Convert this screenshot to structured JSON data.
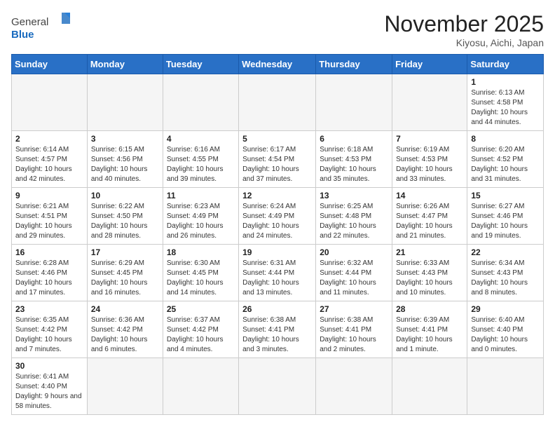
{
  "header": {
    "logo_general": "General",
    "logo_blue": "Blue",
    "month_title": "November 2025",
    "subtitle": "Kiyosu, Aichi, Japan"
  },
  "days_of_week": [
    "Sunday",
    "Monday",
    "Tuesday",
    "Wednesday",
    "Thursday",
    "Friday",
    "Saturday"
  ],
  "weeks": [
    [
      {
        "day": "",
        "info": ""
      },
      {
        "day": "",
        "info": ""
      },
      {
        "day": "",
        "info": ""
      },
      {
        "day": "",
        "info": ""
      },
      {
        "day": "",
        "info": ""
      },
      {
        "day": "",
        "info": ""
      },
      {
        "day": "1",
        "info": "Sunrise: 6:13 AM\nSunset: 4:58 PM\nDaylight: 10 hours and 44 minutes."
      }
    ],
    [
      {
        "day": "2",
        "info": "Sunrise: 6:14 AM\nSunset: 4:57 PM\nDaylight: 10 hours and 42 minutes."
      },
      {
        "day": "3",
        "info": "Sunrise: 6:15 AM\nSunset: 4:56 PM\nDaylight: 10 hours and 40 minutes."
      },
      {
        "day": "4",
        "info": "Sunrise: 6:16 AM\nSunset: 4:55 PM\nDaylight: 10 hours and 39 minutes."
      },
      {
        "day": "5",
        "info": "Sunrise: 6:17 AM\nSunset: 4:54 PM\nDaylight: 10 hours and 37 minutes."
      },
      {
        "day": "6",
        "info": "Sunrise: 6:18 AM\nSunset: 4:53 PM\nDaylight: 10 hours and 35 minutes."
      },
      {
        "day": "7",
        "info": "Sunrise: 6:19 AM\nSunset: 4:53 PM\nDaylight: 10 hours and 33 minutes."
      },
      {
        "day": "8",
        "info": "Sunrise: 6:20 AM\nSunset: 4:52 PM\nDaylight: 10 hours and 31 minutes."
      }
    ],
    [
      {
        "day": "9",
        "info": "Sunrise: 6:21 AM\nSunset: 4:51 PM\nDaylight: 10 hours and 29 minutes."
      },
      {
        "day": "10",
        "info": "Sunrise: 6:22 AM\nSunset: 4:50 PM\nDaylight: 10 hours and 28 minutes."
      },
      {
        "day": "11",
        "info": "Sunrise: 6:23 AM\nSunset: 4:49 PM\nDaylight: 10 hours and 26 minutes."
      },
      {
        "day": "12",
        "info": "Sunrise: 6:24 AM\nSunset: 4:49 PM\nDaylight: 10 hours and 24 minutes."
      },
      {
        "day": "13",
        "info": "Sunrise: 6:25 AM\nSunset: 4:48 PM\nDaylight: 10 hours and 22 minutes."
      },
      {
        "day": "14",
        "info": "Sunrise: 6:26 AM\nSunset: 4:47 PM\nDaylight: 10 hours and 21 minutes."
      },
      {
        "day": "15",
        "info": "Sunrise: 6:27 AM\nSunset: 4:46 PM\nDaylight: 10 hours and 19 minutes."
      }
    ],
    [
      {
        "day": "16",
        "info": "Sunrise: 6:28 AM\nSunset: 4:46 PM\nDaylight: 10 hours and 17 minutes."
      },
      {
        "day": "17",
        "info": "Sunrise: 6:29 AM\nSunset: 4:45 PM\nDaylight: 10 hours and 16 minutes."
      },
      {
        "day": "18",
        "info": "Sunrise: 6:30 AM\nSunset: 4:45 PM\nDaylight: 10 hours and 14 minutes."
      },
      {
        "day": "19",
        "info": "Sunrise: 6:31 AM\nSunset: 4:44 PM\nDaylight: 10 hours and 13 minutes."
      },
      {
        "day": "20",
        "info": "Sunrise: 6:32 AM\nSunset: 4:44 PM\nDaylight: 10 hours and 11 minutes."
      },
      {
        "day": "21",
        "info": "Sunrise: 6:33 AM\nSunset: 4:43 PM\nDaylight: 10 hours and 10 minutes."
      },
      {
        "day": "22",
        "info": "Sunrise: 6:34 AM\nSunset: 4:43 PM\nDaylight: 10 hours and 8 minutes."
      }
    ],
    [
      {
        "day": "23",
        "info": "Sunrise: 6:35 AM\nSunset: 4:42 PM\nDaylight: 10 hours and 7 minutes."
      },
      {
        "day": "24",
        "info": "Sunrise: 6:36 AM\nSunset: 4:42 PM\nDaylight: 10 hours and 6 minutes."
      },
      {
        "day": "25",
        "info": "Sunrise: 6:37 AM\nSunset: 4:42 PM\nDaylight: 10 hours and 4 minutes."
      },
      {
        "day": "26",
        "info": "Sunrise: 6:38 AM\nSunset: 4:41 PM\nDaylight: 10 hours and 3 minutes."
      },
      {
        "day": "27",
        "info": "Sunrise: 6:38 AM\nSunset: 4:41 PM\nDaylight: 10 hours and 2 minutes."
      },
      {
        "day": "28",
        "info": "Sunrise: 6:39 AM\nSunset: 4:41 PM\nDaylight: 10 hours and 1 minute."
      },
      {
        "day": "29",
        "info": "Sunrise: 6:40 AM\nSunset: 4:40 PM\nDaylight: 10 hours and 0 minutes."
      }
    ],
    [
      {
        "day": "30",
        "info": "Sunrise: 6:41 AM\nSunset: 4:40 PM\nDaylight: 9 hours and 58 minutes."
      },
      {
        "day": "",
        "info": ""
      },
      {
        "day": "",
        "info": ""
      },
      {
        "day": "",
        "info": ""
      },
      {
        "day": "",
        "info": ""
      },
      {
        "day": "",
        "info": ""
      },
      {
        "day": "",
        "info": ""
      }
    ]
  ]
}
